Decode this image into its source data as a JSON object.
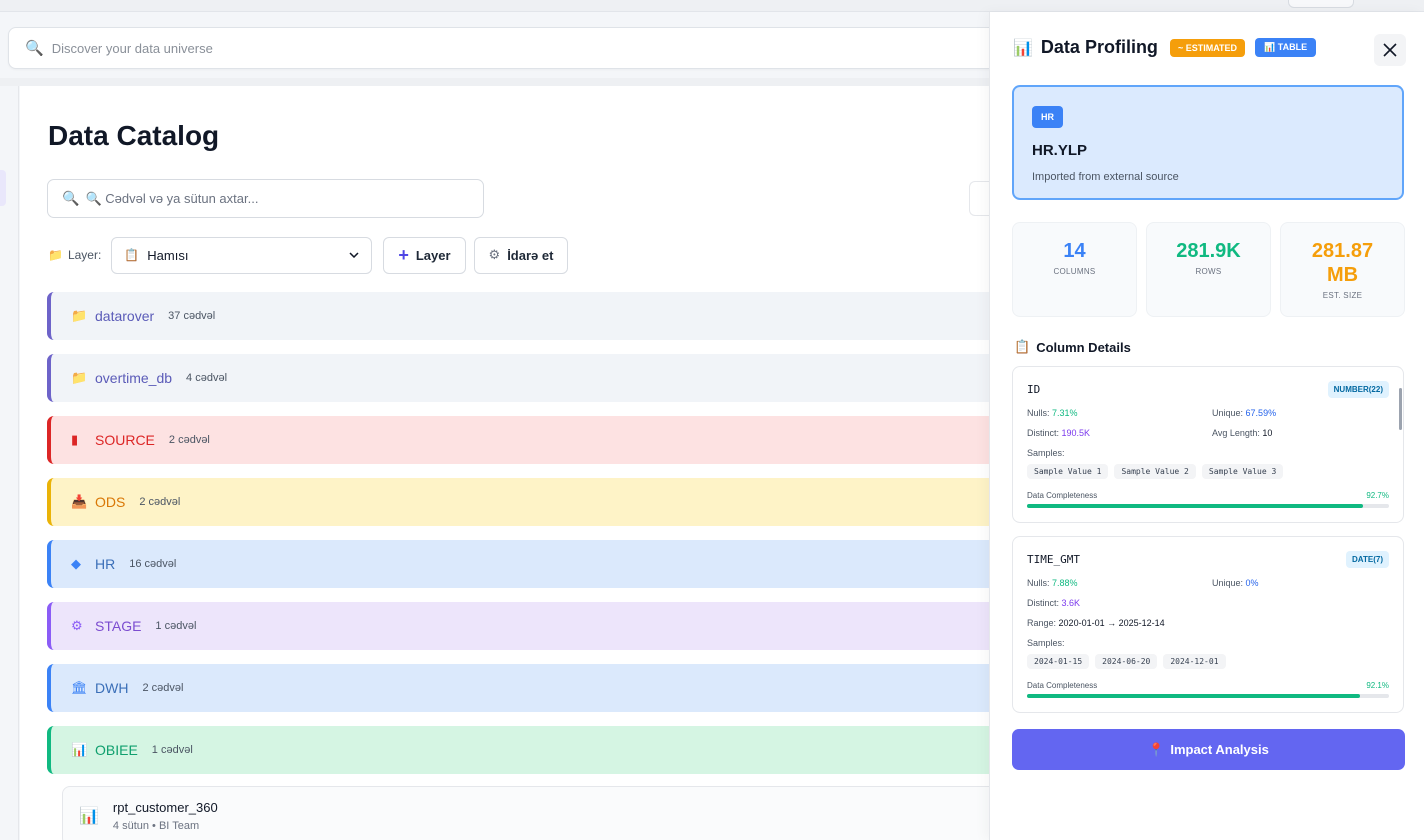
{
  "global_search": {
    "placeholder": "Discover your data universe"
  },
  "catalog": {
    "title": "Data Catalog",
    "search_placeholder": "🔍 Cədvəl və ya sütun axtar...",
    "layer_label": "Layer:",
    "layer_select_value": "Hamısı",
    "add_layer_label": "Layer",
    "manage_label": "İdarə et",
    "layers": [
      {
        "name": "datarover",
        "count": "37 cədvəl",
        "icon": "folder-icon",
        "glyph": "📁",
        "bg": "#f1f4f8",
        "border": "#6d63c9",
        "color": "#5b5bb8"
      },
      {
        "name": "overtime_db",
        "count": "4 cədvəl",
        "icon": "folder-icon",
        "glyph": "📁",
        "bg": "#f1f4f8",
        "border": "#6d63c9",
        "color": "#5b5bb8"
      },
      {
        "name": "SOURCE",
        "count": "2 cədvəl",
        "icon": "server-icon",
        "glyph": "▮",
        "bg": "#fde2e2",
        "border": "#dc2626",
        "color": "#dc2626"
      },
      {
        "name": "ODS",
        "count": "2 cədvəl",
        "icon": "inbox-icon",
        "glyph": "📥",
        "bg": "#fef3c7",
        "border": "#eab308",
        "color": "#d97706"
      },
      {
        "name": "HR",
        "count": "16 cədvəl",
        "icon": "diamond-icon",
        "glyph": "◆",
        "bg": "#dbe9fc",
        "border": "#3b82f6",
        "color": "#3b6fb8"
      },
      {
        "name": "STAGE",
        "count": "1 cədvəl",
        "icon": "gear-icon",
        "glyph": "⚙",
        "bg": "#ede5fb",
        "border": "#8b5cf6",
        "color": "#7c4dd0"
      },
      {
        "name": "DWH",
        "count": "2 cədvəl",
        "icon": "bank-icon",
        "glyph": "🏛",
        "bg": "#dbe9fc",
        "border": "#3b82f6",
        "color": "#3b6fb8"
      },
      {
        "name": "OBIEE",
        "count": "1 cədvəl",
        "icon": "chart-icon",
        "glyph": "📊",
        "bg": "#d5f5e3",
        "border": "#10b981",
        "color": "#0f9f6e"
      }
    ],
    "sub_table": {
      "name": "rpt_customer_360",
      "meta": "4 sütun • BI Team"
    }
  },
  "profiling": {
    "title": "Data Profiling",
    "badge_estimated": "~ ESTIMATED",
    "badge_table": "TABLE",
    "hero": {
      "tag": "HR",
      "name": "HR.YLP",
      "desc": "Imported from external source"
    },
    "stats": [
      {
        "value": "14",
        "label": "COLUMNS",
        "color": "#3b82f6"
      },
      {
        "value": "281.9K",
        "label": "ROWS",
        "color": "#10b981"
      },
      {
        "value": "281.87 MB",
        "label": "EST. SIZE",
        "color": "#f59e0b"
      }
    ],
    "column_details_title": "Column Details",
    "columns": [
      {
        "name": "ID",
        "type": "NUMBER(22)",
        "nulls": "7.31%",
        "unique": "67.59%",
        "distinct": "190.5K",
        "avg_length": "10",
        "samples": [
          "Sample Value 1",
          "Sample Value 2",
          "Sample Value 3"
        ],
        "completeness": "92.7%",
        "completeness_value": 0.927
      },
      {
        "name": "TIME_GMT",
        "type": "DATE(7)",
        "nulls": "7.88%",
        "unique": "0%",
        "distinct": "3.6K",
        "range": "2020-01-01 → 2025-12-14",
        "samples": [
          "2024-01-15",
          "2024-06-20",
          "2024-12-01"
        ],
        "completeness": "92.1%",
        "completeness_value": 0.921
      }
    ],
    "labels": {
      "nulls": "Nulls:",
      "unique": "Unique:",
      "distinct": "Distinct:",
      "avg_length": "Avg Length:",
      "range": "Range:",
      "samples": "Samples:",
      "completeness": "Data Completeness"
    },
    "impact_label": "Impact Analysis"
  }
}
